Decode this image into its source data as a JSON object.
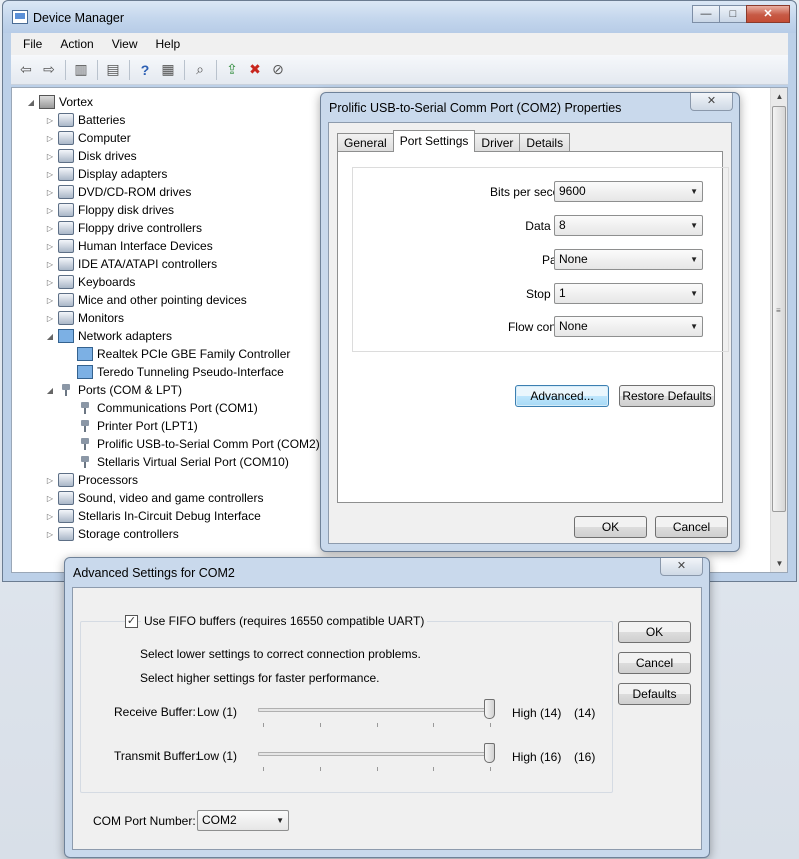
{
  "device_manager": {
    "title": "Device Manager",
    "menu": [
      "File",
      "Action",
      "View",
      "Help"
    ],
    "window_buttons": {
      "minimize": "—",
      "maximize": "□",
      "close": "✕"
    },
    "tree": [
      {
        "label": "Vortex",
        "level": 0,
        "expander": "◢",
        "icon": "computer-icon"
      },
      {
        "label": "Batteries",
        "level": 1,
        "expander": "▷",
        "icon": "battery-icon"
      },
      {
        "label": "Computer",
        "level": 1,
        "expander": "▷",
        "icon": "computer-icon"
      },
      {
        "label": "Disk drives",
        "level": 1,
        "expander": "▷",
        "icon": "disk-drive-icon"
      },
      {
        "label": "Display adapters",
        "level": 1,
        "expander": "▷",
        "icon": "display-adapter-icon"
      },
      {
        "label": "DVD/CD-ROM drives",
        "level": 1,
        "expander": "▷",
        "icon": "dvd-drive-icon"
      },
      {
        "label": "Floppy disk drives",
        "level": 1,
        "expander": "▷",
        "icon": "floppy-icon"
      },
      {
        "label": "Floppy drive controllers",
        "level": 1,
        "expander": "▷",
        "icon": "floppy-controller-icon"
      },
      {
        "label": "Human Interface Devices",
        "level": 1,
        "expander": "▷",
        "icon": "hid-icon"
      },
      {
        "label": "IDE ATA/ATAPI controllers",
        "level": 1,
        "expander": "▷",
        "icon": "ide-controller-icon"
      },
      {
        "label": "Keyboards",
        "level": 1,
        "expander": "▷",
        "icon": "keyboard-icon"
      },
      {
        "label": "Mice and other pointing devices",
        "level": 1,
        "expander": "▷",
        "icon": "mouse-icon"
      },
      {
        "label": "Monitors",
        "level": 1,
        "expander": "▷",
        "icon": "monitor-icon"
      },
      {
        "label": "Network adapters",
        "level": 1,
        "expander": "◢",
        "icon": "network-adapter-icon"
      },
      {
        "label": "Realtek PCIe GBE Family Controller",
        "level": 2,
        "expander": "",
        "icon": "network-adapter-icon"
      },
      {
        "label": "Teredo Tunneling Pseudo-Interface",
        "level": 2,
        "expander": "",
        "icon": "network-adapter-icon"
      },
      {
        "label": "Ports (COM & LPT)",
        "level": 1,
        "expander": "◢",
        "icon": "port-icon"
      },
      {
        "label": "Communications Port (COM1)",
        "level": 2,
        "expander": "",
        "icon": "port-icon"
      },
      {
        "label": "Printer Port (LPT1)",
        "level": 2,
        "expander": "",
        "icon": "port-icon"
      },
      {
        "label": "Prolific USB-to-Serial Comm Port (COM2)",
        "level": 2,
        "expander": "",
        "icon": "port-icon"
      },
      {
        "label": "Stellaris Virtual Serial Port (COM10)",
        "level": 2,
        "expander": "",
        "icon": "port-icon"
      },
      {
        "label": "Processors",
        "level": 1,
        "expander": "▷",
        "icon": "processor-icon"
      },
      {
        "label": "Sound, video and game controllers",
        "level": 1,
        "expander": "▷",
        "icon": "sound-icon"
      },
      {
        "label": "Stellaris In-Circuit Debug Interface",
        "level": 1,
        "expander": "▷",
        "icon": "debug-interface-icon"
      },
      {
        "label": "Storage controllers",
        "level": 1,
        "expander": "▷",
        "icon": "storage-controller-icon"
      }
    ]
  },
  "properties_dialog": {
    "title": "Prolific USB-to-Serial Comm Port (COM2) Properties",
    "close_glyph": "✕",
    "tabs": [
      "General",
      "Port Settings",
      "Driver",
      "Details"
    ],
    "active_tab": "Port Settings",
    "settings": [
      {
        "label": "Bits per second:",
        "value": "9600"
      },
      {
        "label": "Data bits:",
        "value": "8"
      },
      {
        "label": "Parity:",
        "value": "None"
      },
      {
        "label": "Stop bits:",
        "value": "1"
      },
      {
        "label": "Flow control:",
        "value": "None"
      }
    ],
    "advanced_button": "Advanced...",
    "restore_button": "Restore Defaults",
    "ok_button": "OK",
    "cancel_button": "Cancel"
  },
  "advanced_dialog": {
    "title": "Advanced Settings for COM2",
    "close_glyph": "✕",
    "fifo_checkbox_label": "Use FIFO buffers (requires 16550 compatible UART)",
    "fifo_checked": true,
    "hint_lower": "Select lower settings to correct connection problems.",
    "hint_higher": "Select higher settings for faster performance.",
    "receive": {
      "label": "Receive Buffer:",
      "low": "Low (1)",
      "high": "High (14)",
      "value": "(14)",
      "level": 1.0
    },
    "transmit": {
      "label": "Transmit Buffer:",
      "low": "Low (1)",
      "high": "High (16)",
      "value": "(16)",
      "level": 1.0
    },
    "com_port_label": "COM Port Number:",
    "com_port_value": "COM2",
    "ok_button": "OK",
    "cancel_button": "Cancel",
    "defaults_button": "Defaults"
  }
}
